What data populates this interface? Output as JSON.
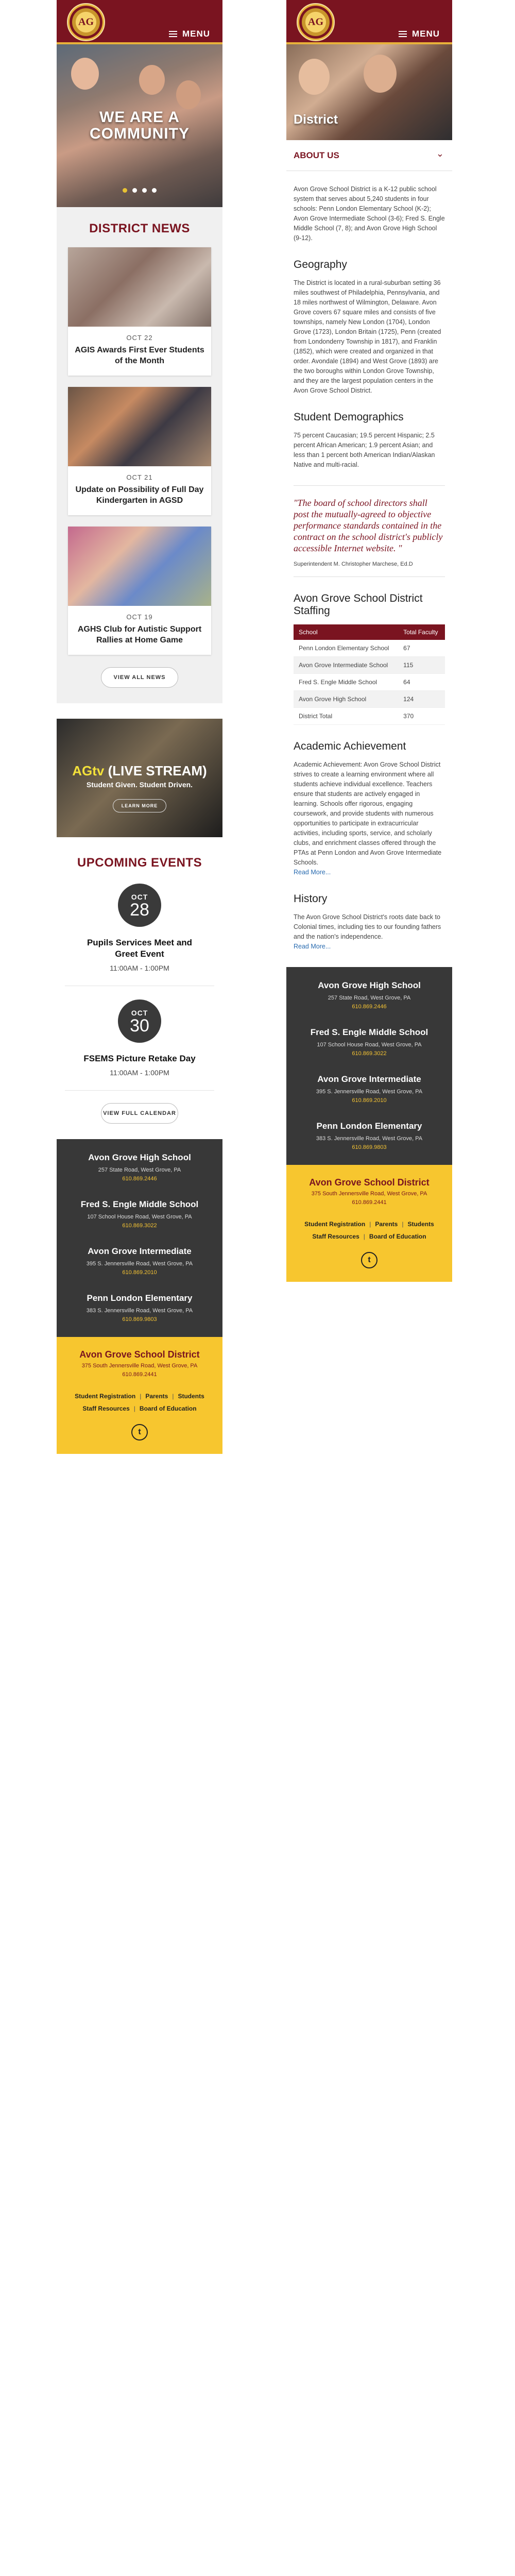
{
  "nav": {
    "menu_label": "MENU",
    "logo_alt": "AG"
  },
  "home": {
    "hero_title_line1": "WE ARE A",
    "hero_title_line2": "COMMUNITY",
    "news_title": "DISTRICT NEWS",
    "news": [
      {
        "date": "OCT 22",
        "headline": "AGIS Awards First Ever Students of the Month"
      },
      {
        "date": "OCT 21",
        "headline": "Update on Possibility of Full Day Kindergarten in AGSD"
      },
      {
        "date": "OCT 19",
        "headline": "AGHS Club for Autistic Support Rallies at Home Game"
      }
    ],
    "view_all_news": "VIEW ALL NEWS",
    "stream": {
      "title_ag": "AGtv",
      "title_rest": " (LIVE STREAM)",
      "subtitle": "Student Given. Student Driven.",
      "button": "LEARN MORE"
    },
    "events_title": "UPCOMING EVENTS",
    "events": [
      {
        "month": "OCT",
        "day": "28",
        "title": "Pupils Services Meet and Greet Event",
        "time": "11:00AM - 1:00PM"
      },
      {
        "month": "OCT",
        "day": "30",
        "title": "FSEMS Picture Retake Day",
        "time": "11:00AM - 1:00PM"
      }
    ],
    "view_calendar": "VIEW FULL CALENDAR"
  },
  "footer": {
    "schools": [
      {
        "name": "Avon Grove High School",
        "address": "257 State Road, West Grove, PA",
        "phone": "610.869.2446"
      },
      {
        "name": "Fred S. Engle Middle School",
        "address": "107 School House Road, West Grove, PA",
        "phone": "610.869.3022"
      },
      {
        "name": "Avon Grove Intermediate",
        "address": "395 S. Jennersville Road, West Grove, PA",
        "phone": "610.869.2010"
      },
      {
        "name": "Penn London Elementary",
        "address": "383 S. Jennersville Road, West Grove, PA",
        "phone": "610.869.9803"
      }
    ],
    "district": {
      "name": "Avon Grove School District",
      "address": "375 South Jennersville Road, West Grove, PA",
      "phone": "610.869.2441"
    },
    "links_row1": [
      "Student Registration",
      "Parents",
      "Students"
    ],
    "links_row2": [
      "Staff Resources",
      "Board of Education"
    ],
    "twitter_glyph": "t"
  },
  "district_page": {
    "hero_title": "District",
    "about_label": "ABOUT US",
    "intro": "Avon Grove School District is a K-12 public school system that serves about 5,240 students in four schools: Penn London Elementary School (K-2); Avon Grove Intermediate School (3-6); Fred S. Engle Middle School (7, 8); and Avon Grove High School (9-12).",
    "geo_title": "Geography",
    "geo_text": "The District is located in a rural-suburban setting 36 miles southwest of Philadelphia, Pennsylvania, and 18 miles northwest of Wilmington, Delaware. Avon Grove covers 67 square miles and consists of five townships, namely New London (1704), London Grove (1723), London Britain (1725), Penn (created from Londonderry Township in 1817), and Franklin (1852), which were created and organized in that order. Avondale (1894) and West Grove (1893) are the two boroughs within London Grove Township, and they are the largest population centers in the Avon Grove School District.",
    "demo_title": "Student Demographics",
    "demo_text": "75 percent Caucasian; 19.5 percent Hispanic; 2.5 percent African American; 1.9 percent Asian; and less than 1 percent both American Indian/Alaskan Native and multi-racial.",
    "quote": "\"The board of school directors shall post the mutually-agreed to objective performance standards contained in the contract on the school district's publicly accessible Internet website. \"",
    "quote_by": "Superintendent M. Christopher Marchese, Ed.D",
    "staff_title": "Avon Grove School District Staffing",
    "staff_headers": [
      "School",
      "Total Faculty"
    ],
    "staff_rows": [
      [
        "Penn London Elementary School",
        "67"
      ],
      [
        "Avon Grove Intermediate School",
        "115"
      ],
      [
        "Fred S. Engle Middle School",
        "64"
      ],
      [
        "Avon Grove High School",
        "124"
      ],
      [
        "District Total",
        "370"
      ]
    ],
    "ach_title": "Academic Achievement",
    "ach_text": "Academic Achievement: Avon Grove School District strives to create a learning environment where all students achieve individual excellence. Teachers ensure that students are actively engaged in learning. Schools offer rigorous, engaging coursework, and provide students with numerous opportunities to participate in extracurricular activities, including sports, service, and scholarly clubs, and enrichment classes offered through the PTAs at Penn London and Avon Grove Intermediate Schools.",
    "read_more": "Read More...",
    "history_title": "History",
    "history_text": "The Avon Grove School District's roots date back to Colonial times, including ties to our founding fathers and the nation's independence."
  },
  "colors": {
    "maroon": "#7a1420",
    "gold": "#f7c62f",
    "dark": "#383838"
  }
}
